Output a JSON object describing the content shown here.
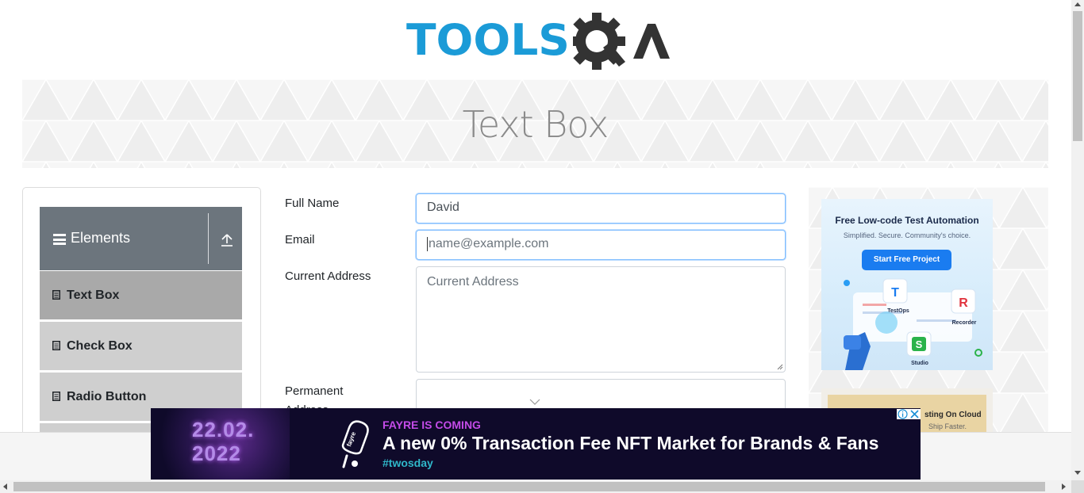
{
  "header": {
    "logo_text": "TOOLS",
    "logo_suffix": "QA",
    "brand_color": "#1b9bd7",
    "logo_dark_color": "#333333"
  },
  "banner": {
    "title": "Text Box"
  },
  "sidebar": {
    "group_title": "Elements",
    "group_icon": "hamburger-icon",
    "collapse_icon": "collapse-up-icon",
    "items": [
      {
        "label": "Text Box",
        "icon": "document-icon",
        "active": true
      },
      {
        "label": "Check Box",
        "icon": "document-icon",
        "active": false
      },
      {
        "label": "Radio Button",
        "icon": "document-icon",
        "active": false
      }
    ]
  },
  "form": {
    "full_name": {
      "label": "Full Name",
      "value": "David"
    },
    "email": {
      "label": "Email",
      "placeholder": "name@example.com",
      "value": ""
    },
    "current_address": {
      "label": "Current Address",
      "placeholder": "Current Address",
      "value": ""
    },
    "permanent_address": {
      "label": "Permanent Address",
      "value": ""
    }
  },
  "right_ads": {
    "ad1": {
      "title": "Free Low-code Test Automation",
      "subtitle": "Simplified. Secure. Community's choice.",
      "button": "Start Free Project",
      "apps": [
        "TestOps",
        "Recorder",
        "Studio"
      ]
    },
    "ad2": {
      "title_fragment": "sting On Cloud",
      "sub_fragment": "Ship Faster."
    }
  },
  "bottom_ad": {
    "art_text_line1": "22.02.",
    "art_text_line2": "2022",
    "kicker": "FAYRE IS COMING",
    "headline": "A new 0% Transaction Fee NFT Market for Brands & Fans",
    "tag": "#twosday",
    "popsicle_text": "fayre",
    "kicker_color": "#c44be8",
    "tag_color": "#2fb7c9"
  },
  "colors": {
    "sidebar_header": "#6c757d",
    "menu_item": "#cfcfcf",
    "menu_item_active": "#a9a9a9",
    "input_focus": "#80bdff"
  }
}
